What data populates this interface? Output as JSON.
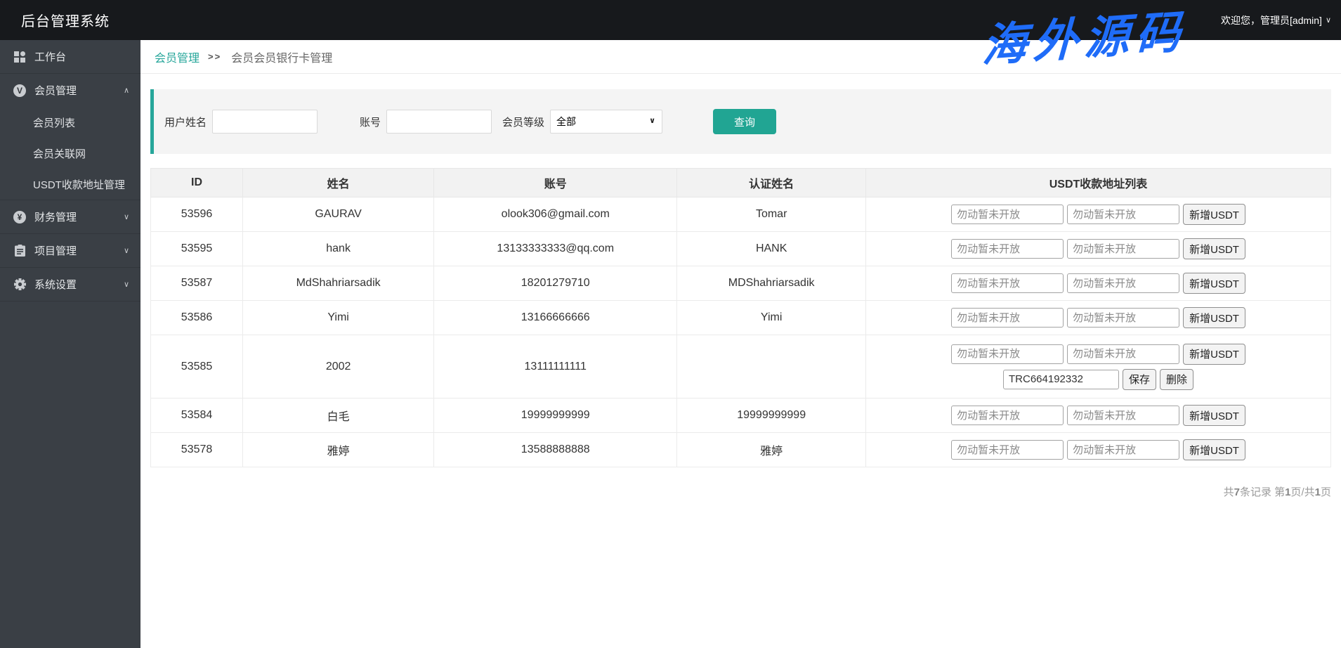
{
  "colors": {
    "topbar": "#17191c",
    "sidebar": "#3a3f45",
    "accent": "#21a593",
    "accent_link": "#26a69a",
    "watermark_blue": "#1f6cf8"
  },
  "app": {
    "title": "后台管理系统"
  },
  "header": {
    "welcome": "欢迎您，管理员[admin]"
  },
  "watermark": {
    "text": "海外源码"
  },
  "icons": {
    "chevron_up": "∧",
    "chevron_down": "∨"
  },
  "sidebar": {
    "items": [
      {
        "key": "workbench",
        "label": "工作台",
        "icon": "grid-icon"
      },
      {
        "key": "member-management",
        "label": "会员管理",
        "icon": "member-icon",
        "icon_letter": "V",
        "chevron": "up",
        "children": [
          {
            "key": "member-list",
            "label": "会员列表"
          },
          {
            "key": "member-network",
            "label": "会员关联网"
          },
          {
            "key": "usdt-address-management",
            "label": "USDT收款地址管理"
          }
        ]
      },
      {
        "key": "finance-management",
        "label": "财务管理",
        "icon": "finance-icon",
        "icon_letter": "¥",
        "chevron": "down"
      },
      {
        "key": "project-management",
        "label": "项目管理",
        "icon": "project-icon",
        "chevron": "down"
      },
      {
        "key": "system-settings",
        "label": "系统设置",
        "icon": "settings-icon",
        "chevron": "down"
      }
    ]
  },
  "breadcrumb": {
    "link": "会员管理",
    "separator": ">>",
    "current": "会员会员银行卡管理"
  },
  "filters": {
    "name_label": "用户姓名",
    "name_value": "",
    "account_label": "账号",
    "account_value": "",
    "level_label": "会员等级",
    "level_value": "全部",
    "search_label": "查询"
  },
  "table": {
    "columns": [
      "ID",
      "姓名",
      "账号",
      "认证姓名",
      "USDT收款地址列表"
    ],
    "usdt_placeholder": "勿动暂未开放",
    "add_usdt_label": "新增USDT",
    "save_label": "保存",
    "delete_label": "删除",
    "rows": [
      {
        "id": "53596",
        "name": "GAURAV",
        "account": "olook306@gmail.com",
        "verified_name": "Tomar"
      },
      {
        "id": "53595",
        "name": "hank",
        "account": "13133333333@qq.com",
        "verified_name": "HANK"
      },
      {
        "id": "53587",
        "name": "MdShahriarsadik",
        "account": "18201279710",
        "verified_name": "MDShahriarsadik"
      },
      {
        "id": "53586",
        "name": "Yimi",
        "account": "13166666666",
        "verified_name": "Yimi"
      },
      {
        "id": "53585",
        "name": "2002",
        "account": "13111111111",
        "verified_name": "",
        "usdt_address": "TRC664192332"
      },
      {
        "id": "53584",
        "name": "白毛",
        "account": "19999999999",
        "verified_name": "19999999999"
      },
      {
        "id": "53578",
        "name": "雅婷",
        "account": "13588888888",
        "verified_name": "雅婷"
      }
    ]
  },
  "pagination": {
    "prefix": "共",
    "total": "7",
    "middle": "条记录 第",
    "page": "1",
    "separator": "页/共",
    "pages": "1",
    "suffix": "页"
  }
}
